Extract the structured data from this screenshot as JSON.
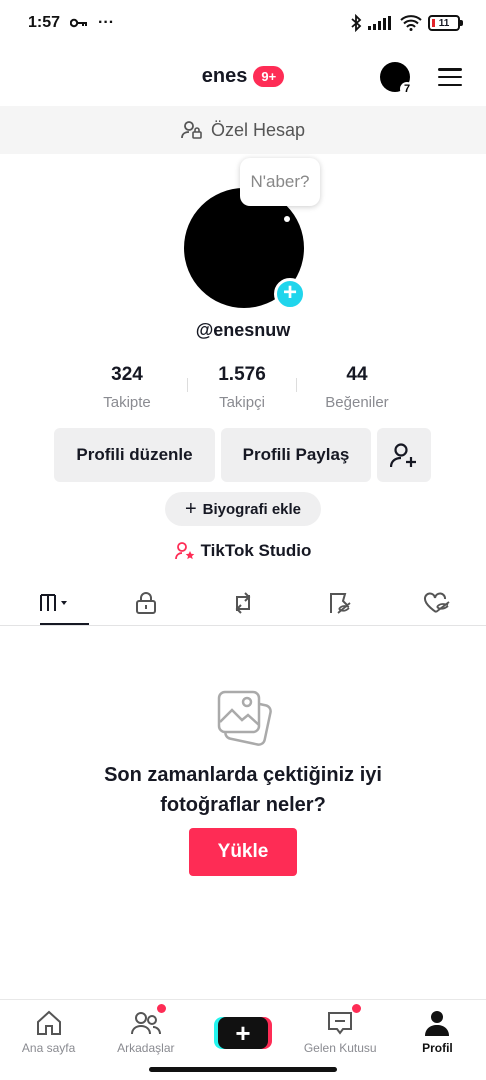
{
  "status_bar": {
    "time": "1:57",
    "battery": "11",
    "key_icon": "key-icon",
    "more": "···"
  },
  "header": {
    "username": "enes",
    "badge": "9+",
    "mini_avatar_count": "7"
  },
  "private_banner": {
    "label": "Özel Hesap"
  },
  "profile": {
    "bubble_text": "N'aber?",
    "add_symbol": "+",
    "handle": "@enesnuw",
    "stats": [
      {
        "value": "324",
        "label": "Takipte"
      },
      {
        "value": "1.576",
        "label": "Takipçi"
      },
      {
        "value": "44",
        "label": "Beğeniler"
      }
    ]
  },
  "actions": {
    "edit_label": "Profili düzenle",
    "share_label": "Profili Paylaş"
  },
  "bio": {
    "plus": "+",
    "label": "Biyografi ekle"
  },
  "studio": {
    "label": "TikTok Studio"
  },
  "tabs": [
    "videos-grid-icon",
    "lock-icon",
    "repost-icon",
    "favorites-icon",
    "liked-icon"
  ],
  "empty_state": {
    "text_line1": "Son zamanlarda çektiğiniz iyi",
    "text_line2": "fotoğraflar neler?",
    "upload_label": "Yükle"
  },
  "bottom_nav": {
    "home": "Ana sayfa",
    "friends": "Arkadaşlar",
    "create": "+",
    "inbox": "Gelen Kutusu",
    "profile": "Profil"
  },
  "colors": {
    "accent": "#fe2c55",
    "cyan": "#20d5ec",
    "text": "#161823",
    "muted": "#8a8b91"
  }
}
